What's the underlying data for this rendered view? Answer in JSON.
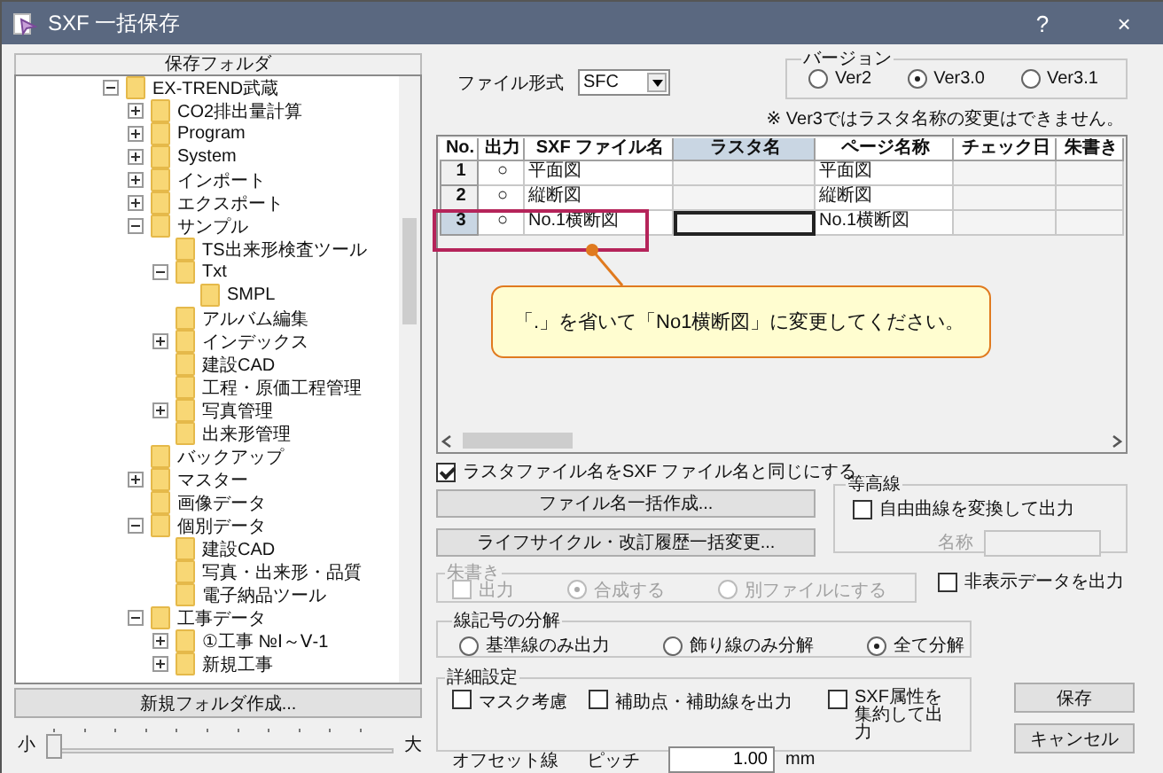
{
  "window": {
    "title": "SXF 一括保存",
    "help": "?",
    "close": "×"
  },
  "folder_panel": {
    "header": "保存フォルダ",
    "tree": [
      {
        "label": "EX-TREND武蔵",
        "expanded": true,
        "children": [
          {
            "label": "CO2排出量計算",
            "expanded": false
          },
          {
            "label": "Program",
            "expanded": false
          },
          {
            "label": "System",
            "expanded": false
          },
          {
            "label": "インポート",
            "expanded": false
          },
          {
            "label": "エクスポート",
            "expanded": false
          },
          {
            "label": "サンプル",
            "expanded": true,
            "children": [
              {
                "label": "TS出来形検査ツール"
              },
              {
                "label": "Txt",
                "expanded": true,
                "children": [
                  {
                    "label": "SMPL"
                  }
                ]
              },
              {
                "label": "アルバム編集"
              },
              {
                "label": "インデックス",
                "expanded": false
              },
              {
                "label": "建設CAD"
              },
              {
                "label": "工程・原価工程管理"
              },
              {
                "label": "写真管理",
                "expanded": false
              },
              {
                "label": "出来形管理"
              }
            ]
          },
          {
            "label": "バックアップ"
          },
          {
            "label": "マスター",
            "expanded": false
          },
          {
            "label": "画像データ"
          },
          {
            "label": "個別データ",
            "expanded": true,
            "children": [
              {
                "label": "建設CAD"
              },
              {
                "label": "写真・出来形・品質"
              },
              {
                "label": "電子納品ツール"
              }
            ]
          },
          {
            "label": "工事データ",
            "expanded": true,
            "children": [
              {
                "label": "①工事 №Ⅰ～Ⅴ-1",
                "expanded": false
              },
              {
                "label": "新規工事",
                "expanded": false
              }
            ]
          }
        ]
      }
    ],
    "new_folder_button": "新規フォルダ作成...",
    "size_slider": {
      "min_label": "小",
      "max_label": "大",
      "level": 0.0
    }
  },
  "file_format": {
    "label": "ファイル形式",
    "value": "SFC"
  },
  "version": {
    "title": "バージョン",
    "options": [
      {
        "label": "Ver2",
        "selected": false
      },
      {
        "label": "Ver3.0",
        "selected": true
      },
      {
        "label": "Ver3.1",
        "selected": false
      }
    ],
    "note": "※ Ver3ではラスタ名称の変更はできません。"
  },
  "table": {
    "columns": [
      {
        "label": "No.",
        "selected": false
      },
      {
        "label": "出力",
        "selected": false
      },
      {
        "label": "SXF ファイル名",
        "selected": false
      },
      {
        "label": "ラスタ名",
        "selected": true
      },
      {
        "label": "ページ名称",
        "selected": false
      },
      {
        "label": "チェック日",
        "selected": false
      },
      {
        "label": "朱書き",
        "selected": false
      }
    ],
    "rows": [
      {
        "no": "1",
        "output": "○",
        "sxf_name": "平面図",
        "page_name": "平面図",
        "selected": false
      },
      {
        "no": "2",
        "output": "○",
        "sxf_name": "縦断図",
        "page_name": "縦断図",
        "selected": false
      },
      {
        "no": "3",
        "output": "○",
        "sxf_name": "No.1横断図",
        "page_name": "No.1横断図",
        "selected": true
      }
    ]
  },
  "callout": {
    "text": "「.」を省いて「No1横断図」に変更してください。"
  },
  "raster_same_name": {
    "label": "ラスタファイル名をSXF ファイル名と同じにする",
    "checked": true
  },
  "buttons": [
    {
      "label": "ファイル名一括作成..."
    },
    {
      "label": "ライフサイクル・改訂履歴一括変更..."
    }
  ],
  "contour": {
    "title": "等高線",
    "convert": {
      "label": "自由曲線を変換して出力",
      "checked": false
    },
    "name_label": "名称",
    "name_disabled": true
  },
  "red_markup": {
    "title": "朱書き",
    "disabled": true,
    "output": {
      "label": "出力",
      "checked": false
    },
    "options": [
      {
        "label": "合成する",
        "selected": true
      },
      {
        "label": "別ファイルにする",
        "selected": false
      }
    ]
  },
  "hidden_data": {
    "label": "非表示データを出力",
    "checked": false
  },
  "line_symbol": {
    "title": "線記号の分解",
    "options": [
      {
        "label": "基準線のみ出力",
        "selected": false
      },
      {
        "label": "飾り線のみ分解",
        "selected": false
      },
      {
        "label": "全て分解",
        "selected": true
      }
    ]
  },
  "details": {
    "title": "詳細設定",
    "checks": [
      {
        "label": "マスク考慮",
        "checked": false
      },
      {
        "label": "補助点・補助線を出力",
        "checked": false
      },
      {
        "label": "SXF属性を集約して出力",
        "checked": false
      }
    ],
    "offset_label": "オフセット線",
    "pitch_label": "ピッチ",
    "pitch_value": "1.00",
    "unit": "mm"
  },
  "save_button": "保存",
  "cancel_button": "キャンセル"
}
